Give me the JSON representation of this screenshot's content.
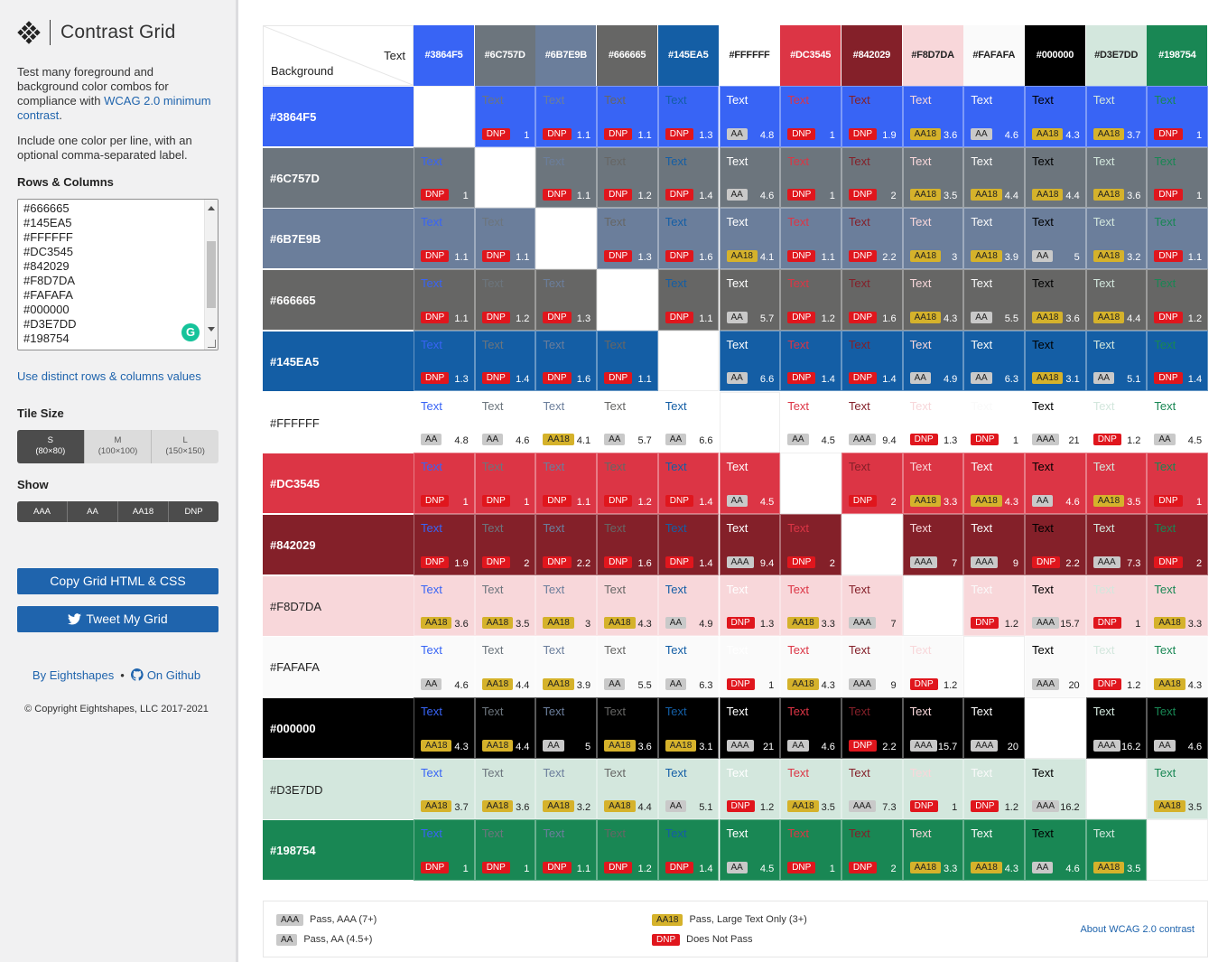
{
  "app": {
    "title": "Contrast Grid",
    "desc1_before": "Test many foreground and background color combos for compliance with ",
    "desc1_link": "WCAG 2.0 minimum contrast",
    "desc1_after": ".",
    "desc2": "Include one color per line, with an optional comma-separated label.",
    "rows_label": "Rows & Columns",
    "textarea_lines": [
      "#666665",
      "#145EA5",
      "#FFFFFF",
      "#DC3545",
      "#842029",
      "#F8D7DA",
      "#FAFAFA",
      "#000000",
      "#D3E7DD",
      "#198754"
    ],
    "distinct_link": "Use distinct rows & columns values",
    "tile_label": "Tile Size",
    "tile_sizes": [
      {
        "name": "S",
        "dim": "(80×80)",
        "on": true
      },
      {
        "name": "M",
        "dim": "(100×100)",
        "on": false
      },
      {
        "name": "L",
        "dim": "(150×150)",
        "on": false
      }
    ],
    "show_label": "Show",
    "show_options": [
      "AAA",
      "AA",
      "AA18",
      "DNP"
    ],
    "copy_button": "Copy Grid HTML & CSS",
    "tweet_button": "Tweet My Grid",
    "by_link": "By Eightshapes",
    "github_link": "On Github",
    "copyright": "© Copyright Eightshapes, LLC 2017-2021"
  },
  "grid": {
    "corner_text": "Text",
    "corner_background": "Background",
    "sample_text": "Text",
    "colors": [
      "#3864F5",
      "#6C757D",
      "#6B7E9B",
      "#666665",
      "#145EA5",
      "#FFFFFF",
      "#DC3545",
      "#842029",
      "#F8D7DA",
      "#FAFAFA",
      "#000000",
      "#D3E7DD",
      "#198754"
    ],
    "rows": [
      [
        null,
        [
          "DNP",
          "1"
        ],
        [
          "DNP",
          "1.1"
        ],
        [
          "DNP",
          "1.1"
        ],
        [
          "DNP",
          "1.3"
        ],
        [
          "AA",
          "4.8"
        ],
        [
          "DNP",
          "1"
        ],
        [
          "DNP",
          "1.9"
        ],
        [
          "AA18",
          "3.6"
        ],
        [
          "AA",
          "4.6"
        ],
        [
          "AA18",
          "4.3"
        ],
        [
          "AA18",
          "3.7"
        ],
        [
          "DNP",
          "1"
        ]
      ],
      [
        [
          "DNP",
          "1"
        ],
        null,
        [
          "DNP",
          "1.1"
        ],
        [
          "DNP",
          "1.2"
        ],
        [
          "DNP",
          "1.4"
        ],
        [
          "AA",
          "4.6"
        ],
        [
          "DNP",
          "1"
        ],
        [
          "DNP",
          "2"
        ],
        [
          "AA18",
          "3.5"
        ],
        [
          "AA18",
          "4.4"
        ],
        [
          "AA18",
          "4.4"
        ],
        [
          "AA18",
          "3.6"
        ],
        [
          "DNP",
          "1"
        ]
      ],
      [
        [
          "DNP",
          "1.1"
        ],
        [
          "DNP",
          "1.1"
        ],
        null,
        [
          "DNP",
          "1.3"
        ],
        [
          "DNP",
          "1.6"
        ],
        [
          "AA18",
          "4.1"
        ],
        [
          "DNP",
          "1.1"
        ],
        [
          "DNP",
          "2.2"
        ],
        [
          "AA18",
          "3"
        ],
        [
          "AA18",
          "3.9"
        ],
        [
          "AA",
          "5"
        ],
        [
          "AA18",
          "3.2"
        ],
        [
          "DNP",
          "1.1"
        ]
      ],
      [
        [
          "DNP",
          "1.1"
        ],
        [
          "DNP",
          "1.2"
        ],
        [
          "DNP",
          "1.3"
        ],
        null,
        [
          "DNP",
          "1.1"
        ],
        [
          "AA",
          "5.7"
        ],
        [
          "DNP",
          "1.2"
        ],
        [
          "DNP",
          "1.6"
        ],
        [
          "AA18",
          "4.3"
        ],
        [
          "AA",
          "5.5"
        ],
        [
          "AA18",
          "3.6"
        ],
        [
          "AA18",
          "4.4"
        ],
        [
          "DNP",
          "1.2"
        ]
      ],
      [
        [
          "DNP",
          "1.3"
        ],
        [
          "DNP",
          "1.4"
        ],
        [
          "DNP",
          "1.6"
        ],
        [
          "DNP",
          "1.1"
        ],
        null,
        [
          "AA",
          "6.6"
        ],
        [
          "DNP",
          "1.4"
        ],
        [
          "DNP",
          "1.4"
        ],
        [
          "AA",
          "4.9"
        ],
        [
          "AA",
          "6.3"
        ],
        [
          "AA18",
          "3.1"
        ],
        [
          "AA",
          "5.1"
        ],
        [
          "DNP",
          "1.4"
        ]
      ],
      [
        [
          "AA",
          "4.8"
        ],
        [
          "AA",
          "4.6"
        ],
        [
          "AA18",
          "4.1"
        ],
        [
          "AA",
          "5.7"
        ],
        [
          "AA",
          "6.6"
        ],
        null,
        [
          "AA",
          "4.5"
        ],
        [
          "AAA",
          "9.4"
        ],
        [
          "DNP",
          "1.3"
        ],
        [
          "DNP",
          "1"
        ],
        [
          "AAA",
          "21"
        ],
        [
          "DNP",
          "1.2"
        ],
        [
          "AA",
          "4.5"
        ]
      ],
      [
        [
          "DNP",
          "1"
        ],
        [
          "DNP",
          "1"
        ],
        [
          "DNP",
          "1.1"
        ],
        [
          "DNP",
          "1.2"
        ],
        [
          "DNP",
          "1.4"
        ],
        [
          "AA",
          "4.5"
        ],
        null,
        [
          "DNP",
          "2"
        ],
        [
          "AA18",
          "3.3"
        ],
        [
          "AA18",
          "4.3"
        ],
        [
          "AA",
          "4.6"
        ],
        [
          "AA18",
          "3.5"
        ],
        [
          "DNP",
          "1"
        ]
      ],
      [
        [
          "DNP",
          "1.9"
        ],
        [
          "DNP",
          "2"
        ],
        [
          "DNP",
          "2.2"
        ],
        [
          "DNP",
          "1.6"
        ],
        [
          "DNP",
          "1.4"
        ],
        [
          "AAA",
          "9.4"
        ],
        [
          "DNP",
          "2"
        ],
        null,
        [
          "AAA",
          "7"
        ],
        [
          "AAA",
          "9"
        ],
        [
          "DNP",
          "2.2"
        ],
        [
          "AAA",
          "7.3"
        ],
        [
          "DNP",
          "2"
        ]
      ],
      [
        [
          "AA18",
          "3.6"
        ],
        [
          "AA18",
          "3.5"
        ],
        [
          "AA18",
          "3"
        ],
        [
          "AA18",
          "4.3"
        ],
        [
          "AA",
          "4.9"
        ],
        [
          "DNP",
          "1.3"
        ],
        [
          "AA18",
          "3.3"
        ],
        [
          "AAA",
          "7"
        ],
        null,
        [
          "DNP",
          "1.2"
        ],
        [
          "AAA",
          "15.7"
        ],
        [
          "DNP",
          "1"
        ],
        [
          "AA18",
          "3.3"
        ]
      ],
      [
        [
          "AA",
          "4.6"
        ],
        [
          "AA18",
          "4.4"
        ],
        [
          "AA18",
          "3.9"
        ],
        [
          "AA",
          "5.5"
        ],
        [
          "AA",
          "6.3"
        ],
        [
          "DNP",
          "1"
        ],
        [
          "AA18",
          "4.3"
        ],
        [
          "AAA",
          "9"
        ],
        [
          "DNP",
          "1.2"
        ],
        null,
        [
          "AAA",
          "20"
        ],
        [
          "DNP",
          "1.2"
        ],
        [
          "AA18",
          "4.3"
        ]
      ],
      [
        [
          "AA18",
          "4.3"
        ],
        [
          "AA18",
          "4.4"
        ],
        [
          "AA",
          "5"
        ],
        [
          "AA18",
          "3.6"
        ],
        [
          "AA18",
          "3.1"
        ],
        [
          "AAA",
          "21"
        ],
        [
          "AA",
          "4.6"
        ],
        [
          "DNP",
          "2.2"
        ],
        [
          "AAA",
          "15.7"
        ],
        [
          "AAA",
          "20"
        ],
        null,
        [
          "AAA",
          "16.2"
        ],
        [
          "AA",
          "4.6"
        ]
      ],
      [
        [
          "AA18",
          "3.7"
        ],
        [
          "AA18",
          "3.6"
        ],
        [
          "AA18",
          "3.2"
        ],
        [
          "AA18",
          "4.4"
        ],
        [
          "AA",
          "5.1"
        ],
        [
          "DNP",
          "1.2"
        ],
        [
          "AA18",
          "3.5"
        ],
        [
          "AAA",
          "7.3"
        ],
        [
          "DNP",
          "1"
        ],
        [
          "DNP",
          "1.2"
        ],
        [
          "AAA",
          "16.2"
        ],
        null,
        [
          "AA18",
          "3.5"
        ]
      ],
      [
        [
          "DNP",
          "1"
        ],
        [
          "DNP",
          "1"
        ],
        [
          "DNP",
          "1.1"
        ],
        [
          "DNP",
          "1.2"
        ],
        [
          "DNP",
          "1.4"
        ],
        [
          "AA",
          "4.5"
        ],
        [
          "DNP",
          "1"
        ],
        [
          "DNP",
          "2"
        ],
        [
          "AA18",
          "3.3"
        ],
        [
          "AA18",
          "4.3"
        ],
        [
          "AA",
          "4.6"
        ],
        [
          "AA18",
          "3.5"
        ],
        null
      ]
    ]
  },
  "legend": {
    "aaa_badge": "AAA",
    "aaa_text": "Pass, AAA (7+)",
    "aa_badge": "AA",
    "aa_text": "Pass, AA (4.5+)",
    "aa18_badge": "AA18",
    "aa18_text": "Pass, Large Text Only (3+)",
    "dnp_badge": "DNP",
    "dnp_text": "Does Not Pass",
    "about_link": "About WCAG 2.0 contrast"
  }
}
